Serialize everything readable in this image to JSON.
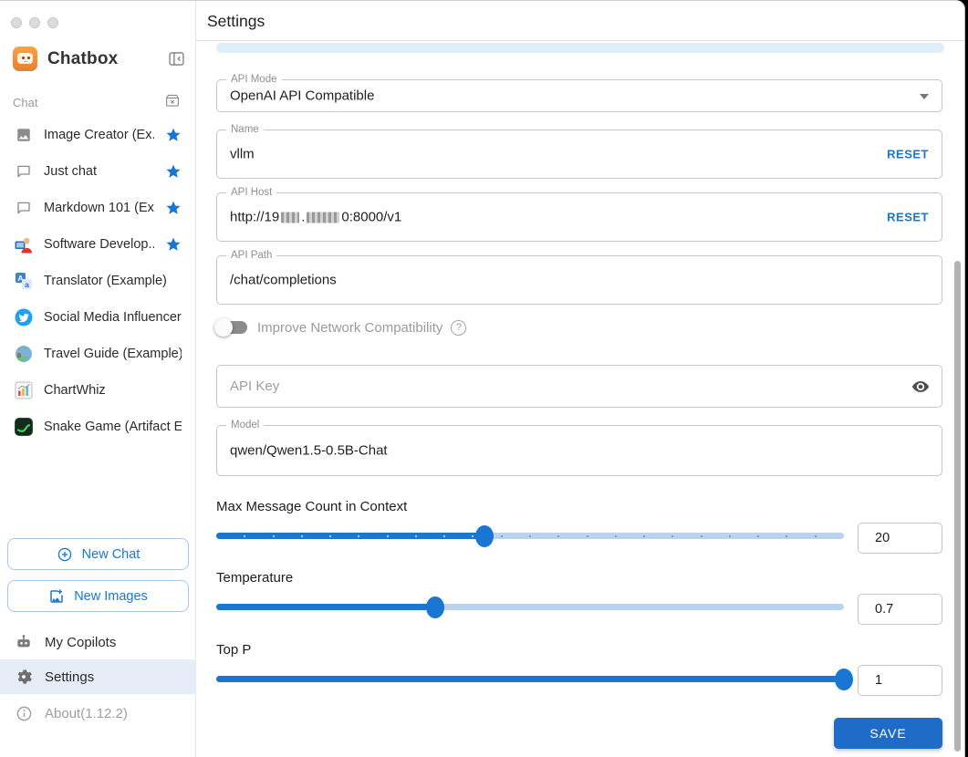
{
  "sidebar": {
    "app_title": "Chatbox",
    "section_label": "Chat",
    "items": [
      {
        "label": "Image Creator (Ex...",
        "icon": "image-icon",
        "starred": true
      },
      {
        "label": "Just chat",
        "icon": "chat-bubble-icon",
        "starred": true
      },
      {
        "label": "Markdown 101 (Ex...",
        "icon": "chat-bubble-icon",
        "starred": true
      },
      {
        "label": "Software Develop...",
        "icon": "developer-avatar-icon",
        "starred": true
      },
      {
        "label": "Translator (Example)",
        "icon": "translator-icon",
        "starred": false
      },
      {
        "label": "Social Media Influencer ...",
        "icon": "twitter-bird-icon",
        "starred": false
      },
      {
        "label": "Travel Guide (Example)",
        "icon": "globe-icon",
        "starred": false
      },
      {
        "label": "ChartWhiz",
        "icon": "chart-icon",
        "starred": false
      },
      {
        "label": "Snake Game (Artifact E...",
        "icon": "snake-game-icon",
        "starred": false
      }
    ],
    "new_chat_label": "New Chat",
    "new_images_label": "New Images",
    "my_copilots_label": "My Copilots",
    "settings_label": "Settings",
    "about_label": "About(1.12.2)"
  },
  "header": {
    "title": "Settings"
  },
  "form": {
    "api_mode": {
      "label": "API Mode",
      "value": "OpenAI API Compatible"
    },
    "name": {
      "label": "Name",
      "value": "vllm",
      "reset_label": "RESET"
    },
    "api_host": {
      "label": "API Host",
      "value_prefix": "http://19",
      "value_mid": ".",
      "value_suffix": "0:8000/v1",
      "redacted": true,
      "reset_label": "RESET"
    },
    "api_path": {
      "label": "API Path",
      "value": "/chat/completions"
    },
    "network_toggle": {
      "label": "Improve Network Compatibility",
      "enabled": false
    },
    "api_key": {
      "placeholder": "API Key"
    },
    "model": {
      "label": "Model",
      "value": "qwen/Qwen1.5-0.5B-Chat"
    },
    "sliders": [
      {
        "label": "Max Message Count in Context",
        "value": "20",
        "percent": 42.7,
        "marks": true
      },
      {
        "label": "Temperature",
        "value": "0.7",
        "percent": 34.9,
        "marks": false
      },
      {
        "label": "Top P",
        "value": "1",
        "percent": 100,
        "marks": false
      }
    ],
    "save_label": "SAVE"
  },
  "colors": {
    "accent": "#1976d2",
    "save_button": "#1e6cc7",
    "star": "#1976d2",
    "selected_row_bg": "#e7edf7",
    "alert_strip_bg": "#ddeef9",
    "slider_track": "#b9d2ee",
    "switch_track": "#8b8b8b"
  }
}
